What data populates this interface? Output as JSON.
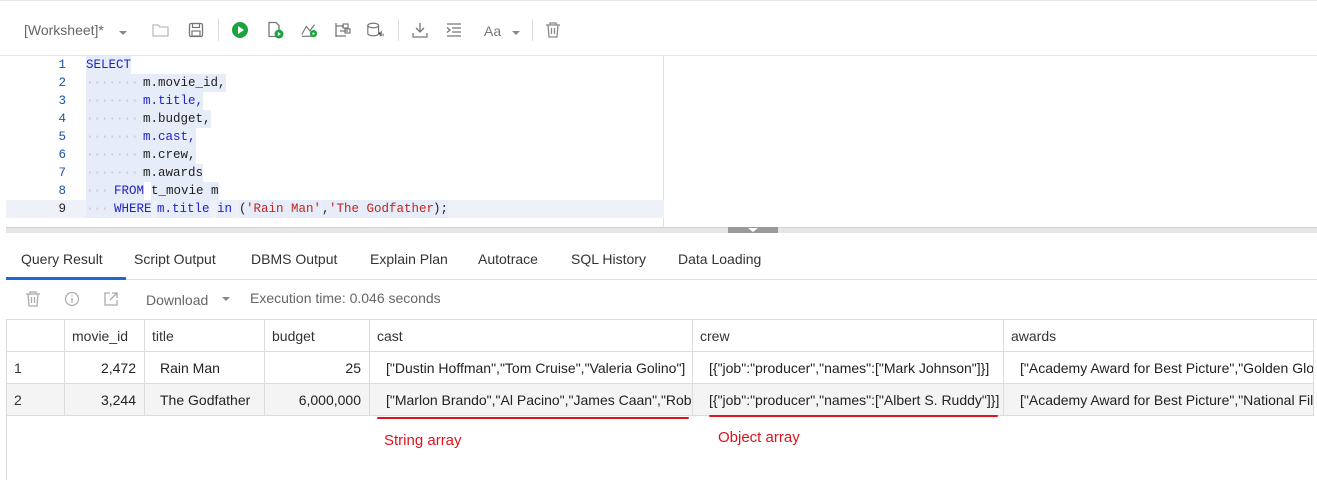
{
  "toolbar": {
    "worksheet_label": "[Worksheet]*",
    "icons": [
      "open-icon",
      "save-icon",
      "run-statement-icon",
      "run-script-icon",
      "explain-plan-icon",
      "autotrace-icon",
      "sql-tuning-icon",
      "download-icon",
      "format-icon",
      "font-case-icon",
      "clear-icon"
    ],
    "font_case_label": "Aa",
    "run_color": "#1aa33f"
  },
  "editor": {
    "line_numbers": [
      "1",
      "2",
      "3",
      "4",
      "5",
      "6",
      "7",
      "8",
      "9"
    ],
    "lines": {
      "l1_kw": "SELECT",
      "l2": "m.movie_id,",
      "l3": "m.title,",
      "l4": "m.budget,",
      "l5": "m.cast,",
      "l6": "m.crew,",
      "l7": "m.awards",
      "l8_kw": "FROM",
      "l8_rest": "t_movie m",
      "l9_kw": "WHERE",
      "l9_a": "m.title",
      "l9_in": "in",
      "l9_p1": "(",
      "l9_s1": "'Rain Man'",
      "l9_comma": ",",
      "l9_s2": "'The Godfather'",
      "l9_end": ");"
    }
  },
  "tabs": [
    {
      "label": "Query Result",
      "active": true
    },
    {
      "label": "Script Output"
    },
    {
      "label": "DBMS Output"
    },
    {
      "label": "Explain Plan"
    },
    {
      "label": "Autotrace"
    },
    {
      "label": "SQL History"
    },
    {
      "label": "Data Loading"
    }
  ],
  "result_toolbar": {
    "download_label": "Download",
    "execution_time": "Execution time: 0.046 seconds"
  },
  "grid": {
    "columns": [
      "movie_id",
      "title",
      "budget",
      "cast",
      "crew",
      "awards"
    ],
    "rows": [
      {
        "num": "1",
        "movie_id": "2,472",
        "title": "Rain Man",
        "budget": "25",
        "cast": "[\"Dustin Hoffman\",\"Tom Cruise\",\"Valeria Golino\"]",
        "crew": "[{\"job\":\"producer\",\"names\":[\"Mark Johnson\"]}]",
        "awards": "[\"Academy Award for Best Picture\",\"Golden Globe\"]"
      },
      {
        "num": "2",
        "movie_id": "3,244",
        "title": "The Godfather",
        "budget": "6,000,000",
        "cast": "[\"Marlon Brando\",\"Al Pacino\",\"James Caan\",\"Robert Duvall\"]",
        "crew": "[{\"job\":\"producer\",\"names\":[\"Albert S. Ruddy\"]}]",
        "awards": "[\"Academy Award for Best Picture\",\"National Film Registry\"]"
      }
    ]
  },
  "annotations": {
    "string_array": "String array",
    "object_array": "Object array",
    "color": "#e0131d"
  }
}
